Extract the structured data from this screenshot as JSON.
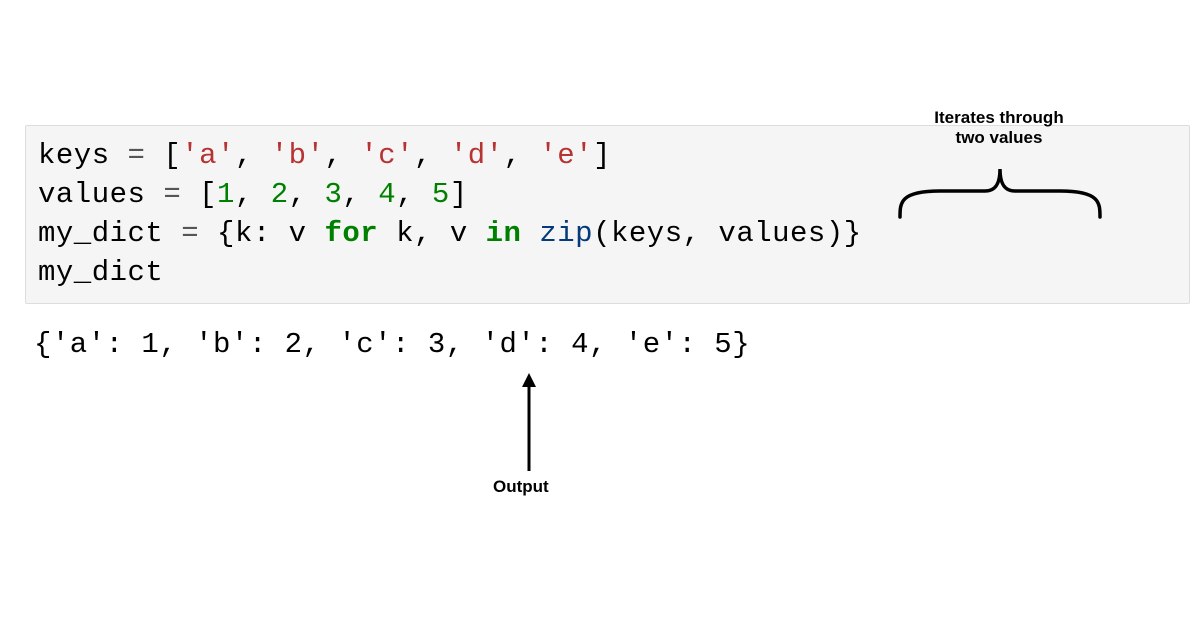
{
  "code": {
    "line1": {
      "keys_var": "keys",
      "eq": " = ",
      "lbr": "[",
      "s1": "'a'",
      "c1": ", ",
      "s2": "'b'",
      "c2": ", ",
      "s3": "'c'",
      "c3": ", ",
      "s4": "'d'",
      "c4": ", ",
      "s5": "'e'",
      "rbr": "]"
    },
    "line2": {
      "values_var": "values",
      "eq": " = ",
      "lbr": "[",
      "n1": "1",
      "c1": ", ",
      "n2": "2",
      "c2": ", ",
      "n3": "3",
      "c3": ", ",
      "n4": "4",
      "c4": ", ",
      "n5": "5",
      "rbr": "]"
    },
    "line3": {
      "dict_var": "my_dict",
      "eq": " = ",
      "lbr": "{",
      "k": "k",
      "colon": ": ",
      "v": "v",
      "sp1": " ",
      "for_kw": "for",
      "sp2": " ",
      "k2": "k",
      "comma": ", ",
      "v2": "v",
      "sp3": " ",
      "in_kw": "in",
      "sp4": " ",
      "zip_fn": "zip",
      "lp": "(",
      "keys_arg": "keys",
      "argcomma": ", ",
      "values_arg": "values",
      "rp": ")",
      "rbr": "}"
    },
    "line4": {
      "dict_var": "my_dict"
    }
  },
  "output": "{'a': 1, 'b': 2, 'c': 3, 'd': 4, 'e': 5}",
  "annotations": {
    "top": "Iterates through\ntwo values",
    "bottom": "Output"
  }
}
